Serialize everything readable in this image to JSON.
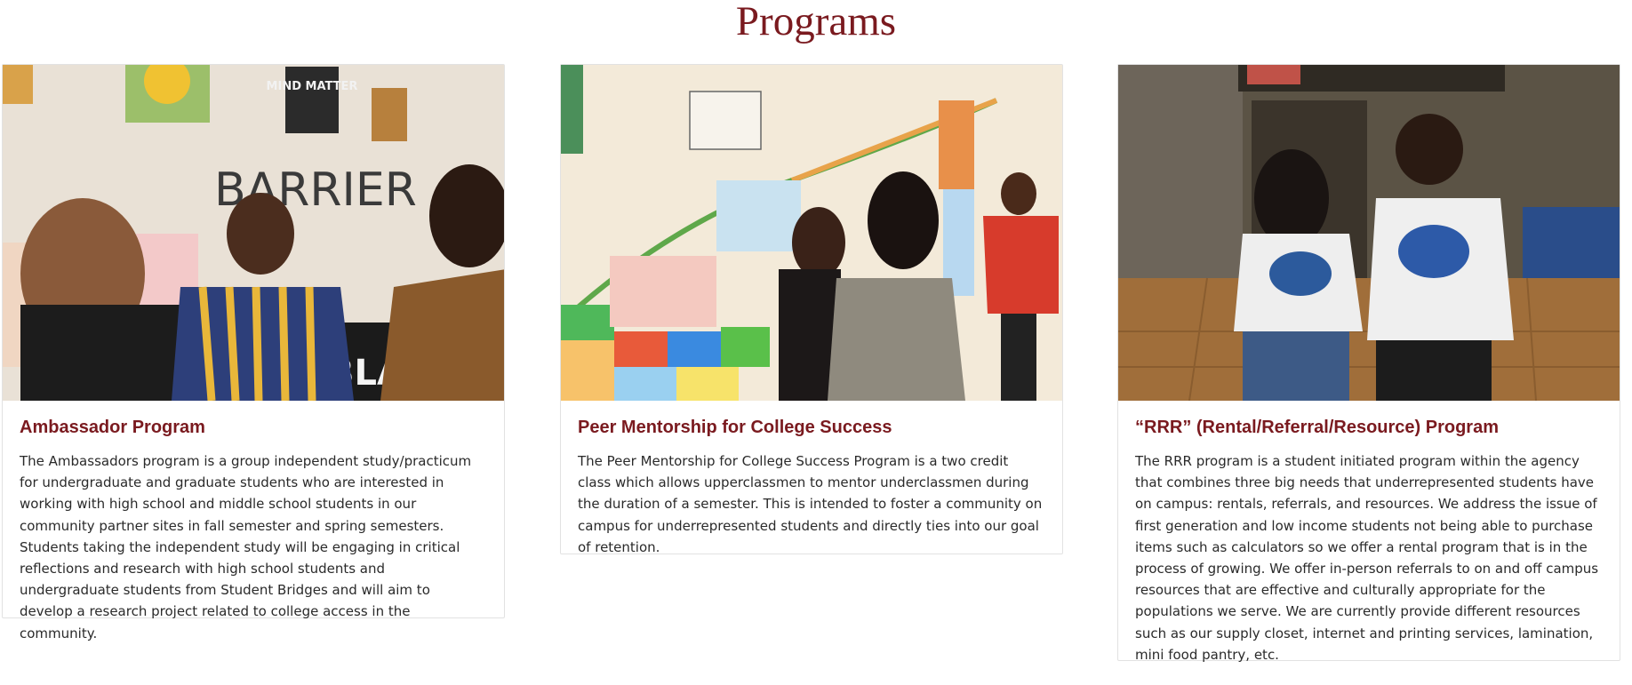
{
  "page": {
    "title": "Programs"
  },
  "cards": [
    {
      "title": "Ambassador Program",
      "text": "The Ambassadors program is a group independent study/practicum for undergraduate and graduate students who are interested in working with high school and middle school students in our community partner sites in fall semester and spring semesters. Students taking the independent study will be engaging in critical reflections and research with high school students and undergraduate students from Student Bridges and will aim to develop a research project related to college access in the community.",
      "image_signs": {
        "poster": "MIND MATTER",
        "wall": "BARRIER",
        "banner": "BLA"
      }
    },
    {
      "title": "Peer Mentorship for College Success",
      "text": "The Peer Mentorship for College Success Program is a two credit class which allows upperclassmen to mentor underclassmen during the duration of a semester. This is intended to foster a community on campus for underrepresented students and directly ties into our goal of retention."
    },
    {
      "title": "“RRR” (Rental/Referral/Resource) Program",
      "text": "The RRR program is a student initiated program within the agency that combines three big needs that underrepresented students have on campus: rentals, referrals, and resources. We address the issue of first generation and low income students not being able to purchase items such as calculators so we offer a rental program that is in the process of growing. We offer in-person referrals to on and off campus resources that are effective and culturally appropriate for the populations we serve. We are currently provide different resources such as our supply closet, internet and printing services, lamination, mini food pantry, etc."
    }
  ],
  "colors": {
    "accent": "#7a1a1f",
    "card_border": "#e2e2e2"
  }
}
